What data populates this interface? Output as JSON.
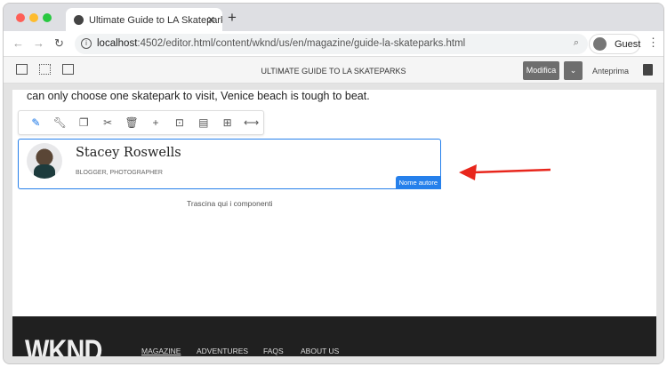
{
  "browser": {
    "tab_title": "Ultimate Guide to LA Skateparks",
    "url_host": "localhost",
    "url_rest": ":4502/editor.html/content/wknd/us/en/magazine/guide-la-skateparks.html",
    "profile": "Guest"
  },
  "editor": {
    "page_title": "ULTIMATE GUIDE TO LA SKATEPARKS",
    "edit_label": "Modifica",
    "preview_label": "Anteprima"
  },
  "page": {
    "paragraph": "can only choose one skatepark to visit, Venice beach is tough to beat.",
    "author": {
      "name": "Stacey Roswells",
      "role": "BLOGGER, PHOTOGRAPHER",
      "component_label": "Nome autore"
    },
    "drop_hint": "Trascina qui i componenti"
  },
  "footer": {
    "logo": "WKND",
    "nav": [
      "MAGAZINE",
      "ADVENTURES",
      "FAQS",
      "ABOUT US"
    ]
  },
  "colors": {
    "accent": "#2680eb",
    "arrow": "#e8261c"
  }
}
